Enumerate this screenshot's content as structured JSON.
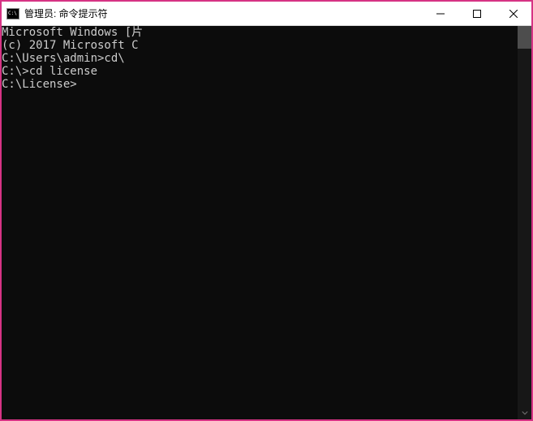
{
  "titlebar": {
    "title": "管理员: 命令提示符"
  },
  "terminal": {
    "lines": [
      "Microsoft Windows [片",
      "(c) 2017 Microsoft C",
      "",
      "C:\\Users\\admin>cd\\",
      "",
      "C:\\>cd license",
      "",
      "C:\\License>"
    ]
  }
}
